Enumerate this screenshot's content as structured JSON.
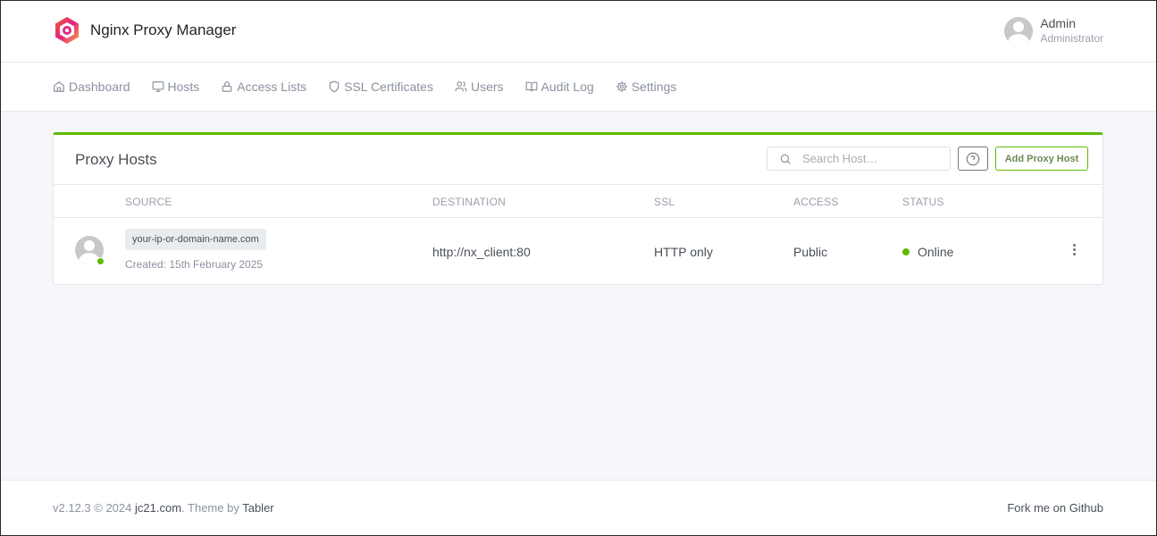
{
  "app": {
    "title": "Nginx Proxy Manager"
  },
  "user": {
    "name": "Admin",
    "role": "Administrator"
  },
  "nav": {
    "items": [
      {
        "label": "Dashboard",
        "icon": "home-icon"
      },
      {
        "label": "Hosts",
        "icon": "monitor-icon"
      },
      {
        "label": "Access Lists",
        "icon": "lock-icon"
      },
      {
        "label": "SSL Certificates",
        "icon": "shield-icon"
      },
      {
        "label": "Users",
        "icon": "users-icon"
      },
      {
        "label": "Audit Log",
        "icon": "book-icon"
      },
      {
        "label": "Settings",
        "icon": "gear-icon"
      }
    ]
  },
  "card": {
    "title": "Proxy Hosts",
    "search_placeholder": "Search Host…",
    "add_button": "Add Proxy Host",
    "accent_color": "#5eba00",
    "columns": [
      "SOURCE",
      "DESTINATION",
      "SSL",
      "ACCESS",
      "STATUS"
    ],
    "rows": [
      {
        "domain": "your-ip-or-domain-name.com",
        "created": "Created: 15th February 2025",
        "destination": "http://nx_client:80",
        "ssl": "HTTP only",
        "access": "Public",
        "status": "Online",
        "status_color": "#5eba00"
      }
    ]
  },
  "footer": {
    "version": "v2.12.3 © 2024",
    "site": "jc21.com",
    "theme_prefix": ". Theme by",
    "theme": "Tabler",
    "fork": "Fork me on Github"
  }
}
